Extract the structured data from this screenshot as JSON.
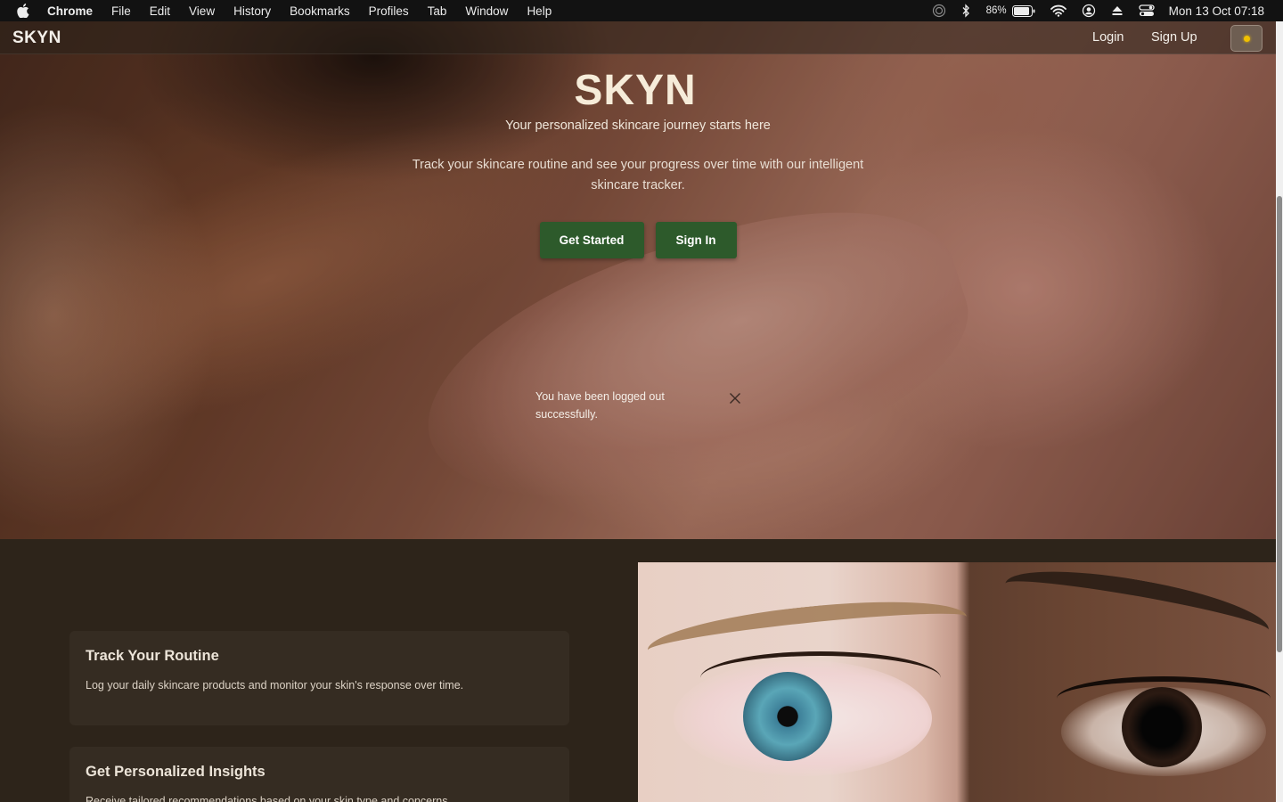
{
  "menubar": {
    "app_name": "Chrome",
    "items": [
      "File",
      "Edit",
      "View",
      "History",
      "Bookmarks",
      "Profiles",
      "Tab",
      "Window",
      "Help"
    ],
    "battery_percent": "86%",
    "clock": "Mon 13 Oct  07:18",
    "tray_icons": [
      "airdrop-icon",
      "bluetooth-icon",
      "battery-icon",
      "wifi-icon",
      "user-icon",
      "eject-icon",
      "control-center-icon"
    ]
  },
  "navbar": {
    "logo": "SKYN",
    "login": "Login",
    "signup": "Sign Up",
    "theme_toggle_icon": "sun-icon"
  },
  "hero": {
    "title": "SKYN",
    "subtitle": "Your personalized skincare journey starts here",
    "description": "Track your skincare routine and see your progress over time with our intelligent skincare tracker.",
    "primary_button": "Get Started",
    "secondary_button": "Sign In"
  },
  "toast": {
    "message": "You have been logged out successfully.",
    "close_icon": "close-icon"
  },
  "features": {
    "cards": [
      {
        "title": "Track Your Routine",
        "text": "Log your daily skincare products and monitor your skin's response over time."
      },
      {
        "title": "Get Personalized Insights",
        "text": "Receive tailored recommendations based on your skin type and concerns."
      }
    ]
  },
  "colors": {
    "brand_green": "#2d5a2b",
    "page_background": "#2d241a",
    "card_background": "#352c22",
    "hero_title": "#f6ecd9"
  }
}
